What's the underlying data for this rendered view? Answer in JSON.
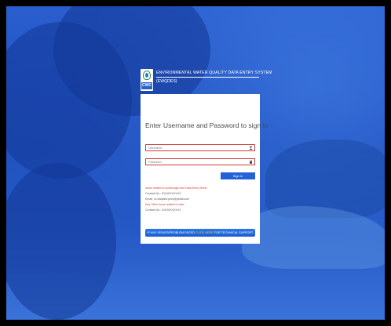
{
  "brand": {
    "title": "ENVIRONMENTAL WATER QUALITY DATA ENTRY SYSTEM",
    "subtitle": "(EWQDES)",
    "logo_text": "CWC"
  },
  "login": {
    "heading": "Enter Username and Password to sign in",
    "username_placeholder": "Username",
    "password_placeholder": "Password",
    "signin_label": "Sign In"
  },
  "contact": {
    "line1": "Issue related to portal login and Data Entry Sheet",
    "line2": "Contact No.: 0119XXXXXXX",
    "line3": "Email: cc-ewqdes.pmu@gmail.com",
    "line4": "Any Other issue related to data",
    "line5": "Contact No.: 0119XXXXXXX"
  },
  "support": {
    "text_before": "IF ANY ISSUES/PROBLEM FACED",
    "highlight": "CLICK HERE",
    "text_after": "FOR TECHNICAL SUPPORT"
  },
  "colors": {
    "accent": "#2262d6",
    "error": "#d63a2a",
    "highlight": "#f2d23a"
  }
}
